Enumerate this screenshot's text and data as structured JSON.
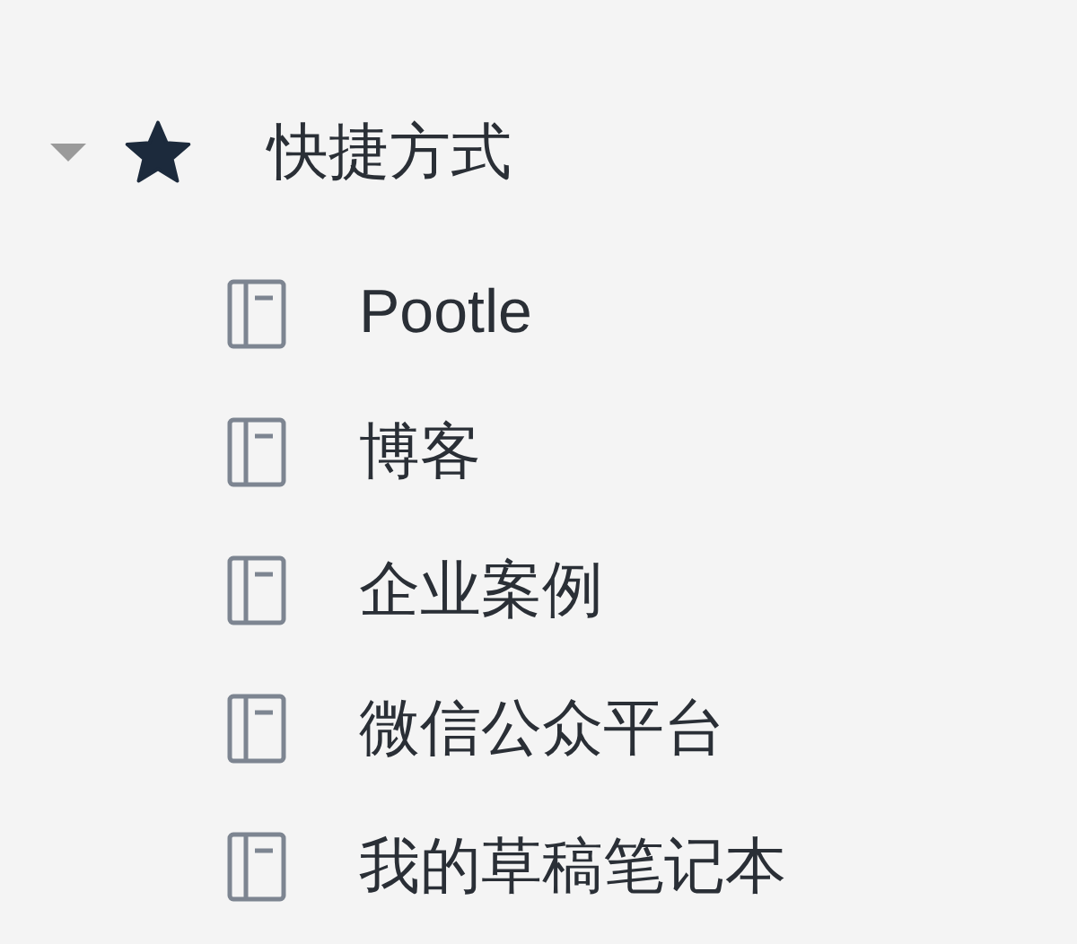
{
  "tree": [
    {
      "label": "快捷方式",
      "expanded": true,
      "children": [
        {
          "label": "Pootle"
        },
        {
          "label": "博客"
        },
        {
          "label": "企业案例"
        },
        {
          "label": "微信公众平台"
        },
        {
          "label": "我的草稿笔记本"
        }
      ]
    }
  ]
}
